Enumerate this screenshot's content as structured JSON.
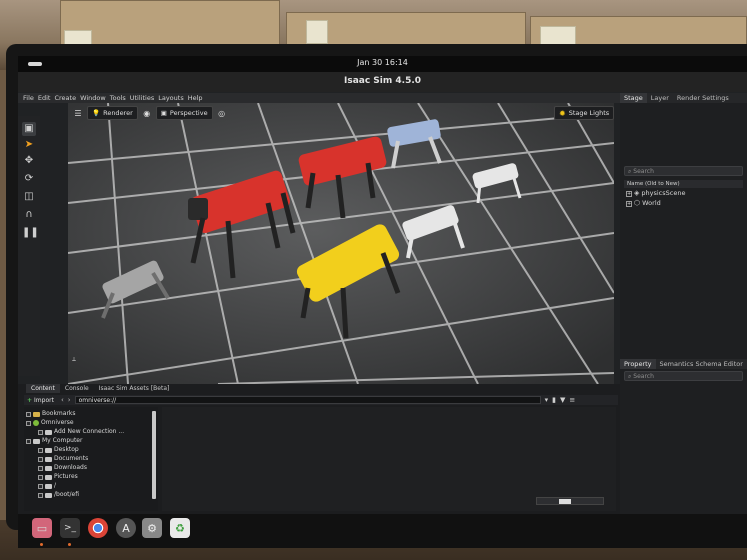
{
  "system": {
    "clock": "Jan 30  16:14"
  },
  "window": {
    "title": "Isaac Sim 4.5.0"
  },
  "menubar": [
    "File",
    "Edit",
    "Create",
    "Window",
    "Tools",
    "Utilities",
    "Layouts",
    "Help"
  ],
  "viewport_toolbar": {
    "renderer": "Renderer",
    "camera": "Perspective",
    "stage_lights": "Stage Lights"
  },
  "right_panel": {
    "tabs": [
      "Stage",
      "Layer",
      "Render Settings"
    ],
    "search_placeholder": "Search",
    "tree_header": "Name (Old to New)",
    "items": [
      "physicsScene",
      "World"
    ],
    "bottom_tabs": [
      "Property",
      "Semantics Schema Editor"
    ],
    "bottom_search_placeholder": "Search"
  },
  "content": {
    "tabs": [
      "Content",
      "Console",
      "Isaac Sim Assets [Beta]"
    ],
    "import_label": "Import",
    "path": "omniverse://",
    "tree": [
      "Bookmarks",
      "Omniverse",
      "Add New Connection ...",
      "My Computer",
      "Desktop",
      "Documents",
      "Downloads",
      "Pictures",
      "/",
      "/boot/efi"
    ]
  },
  "colors": {
    "accent_red": "#d8332c",
    "accent_yellow": "#f2cf1c",
    "omni_green": "#7dbb3a"
  },
  "dock": [
    "files-icon",
    "terminal-icon",
    "chrome-icon",
    "app-store-icon",
    "settings-icon",
    "recycle-bin-icon"
  ]
}
